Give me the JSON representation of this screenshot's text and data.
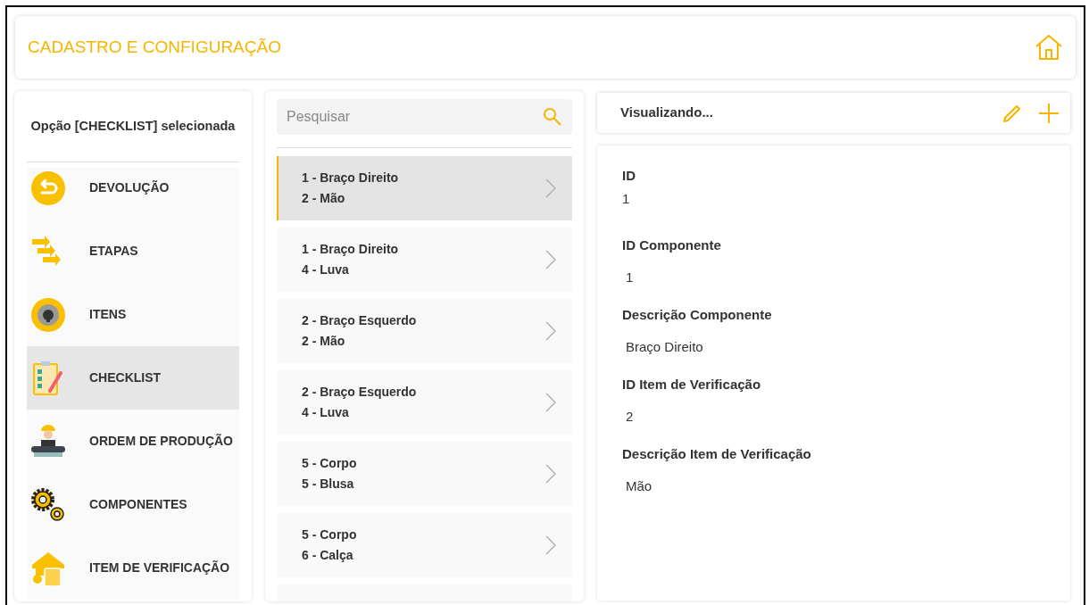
{
  "header": {
    "title": "CADASTRO E CONFIGURAÇÃO"
  },
  "sidebar": {
    "caption": "Opção [CHECKLIST] selecionada",
    "items": [
      {
        "label": "DEVOLUÇÃO",
        "selected": false
      },
      {
        "label": "ETAPAS",
        "selected": false
      },
      {
        "label": "ITENS",
        "selected": false
      },
      {
        "label": "CHECKLIST",
        "selected": true
      },
      {
        "label": "ORDEM DE PRODUÇÃO",
        "selected": false
      },
      {
        "label": "COMPONENTES",
        "selected": false
      },
      {
        "label": "ITEM DE VERIFICAÇÃO",
        "selected": false
      }
    ]
  },
  "search": {
    "placeholder": "Pesquisar"
  },
  "records": [
    {
      "lines": [
        "1 - Braço Direito",
        "2 - Mão"
      ],
      "selected": true
    },
    {
      "lines": [
        "1 - Braço Direito",
        "4 - Luva"
      ],
      "selected": false
    },
    {
      "lines": [
        "2 - Braço Esquerdo",
        "2 - Mão"
      ],
      "selected": false
    },
    {
      "lines": [
        "2 - Braço Esquerdo",
        "4 - Luva"
      ],
      "selected": false
    },
    {
      "lines": [
        "5 - Corpo",
        "5 - Blusa"
      ],
      "selected": false
    },
    {
      "lines": [
        "5 - Corpo",
        "6 - Calça"
      ],
      "selected": false
    },
    {
      "selected": false
    }
  ],
  "detail": {
    "mode": "Visualizando...",
    "fields": [
      {
        "label": "ID",
        "value": "1"
      },
      {
        "label": "ID Componente",
        "value": "1"
      },
      {
        "label": "Descrição Componente",
        "value": "Braço Direito"
      },
      {
        "label": "ID Item de Verificação",
        "value": "2"
      },
      {
        "label": "Descrição Item de Verificação",
        "value": "Mão"
      }
    ]
  }
}
